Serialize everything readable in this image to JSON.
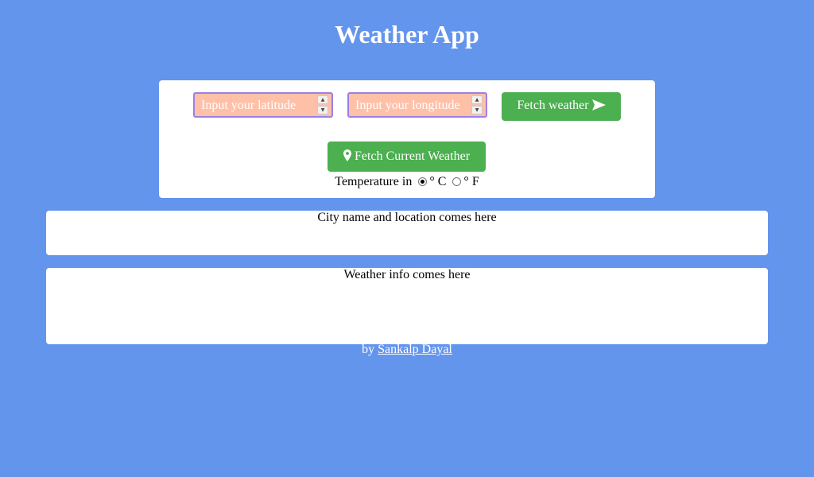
{
  "header": {
    "title": "Weather App"
  },
  "controls": {
    "latitude_placeholder": "Input your latitude",
    "longitude_placeholder": "Input your longitude",
    "fetch_button_label": "Fetch weather",
    "current_button_label": "Fetch Current Weather",
    "temperature_label": "Temperature in",
    "unit_celsius_label": "° C",
    "unit_fahrenheit_label": "° F",
    "selected_unit": "C"
  },
  "panels": {
    "city_text": "City name and location comes here",
    "weather_text": "Weather info comes here"
  },
  "footer": {
    "by_text": "by",
    "author_link": "Sankalp Dayal"
  },
  "colors": {
    "background": "#6495ED",
    "button": "#4CAF50",
    "input_fill": "#FFC0A8",
    "input_border": "#9B7FE6"
  }
}
